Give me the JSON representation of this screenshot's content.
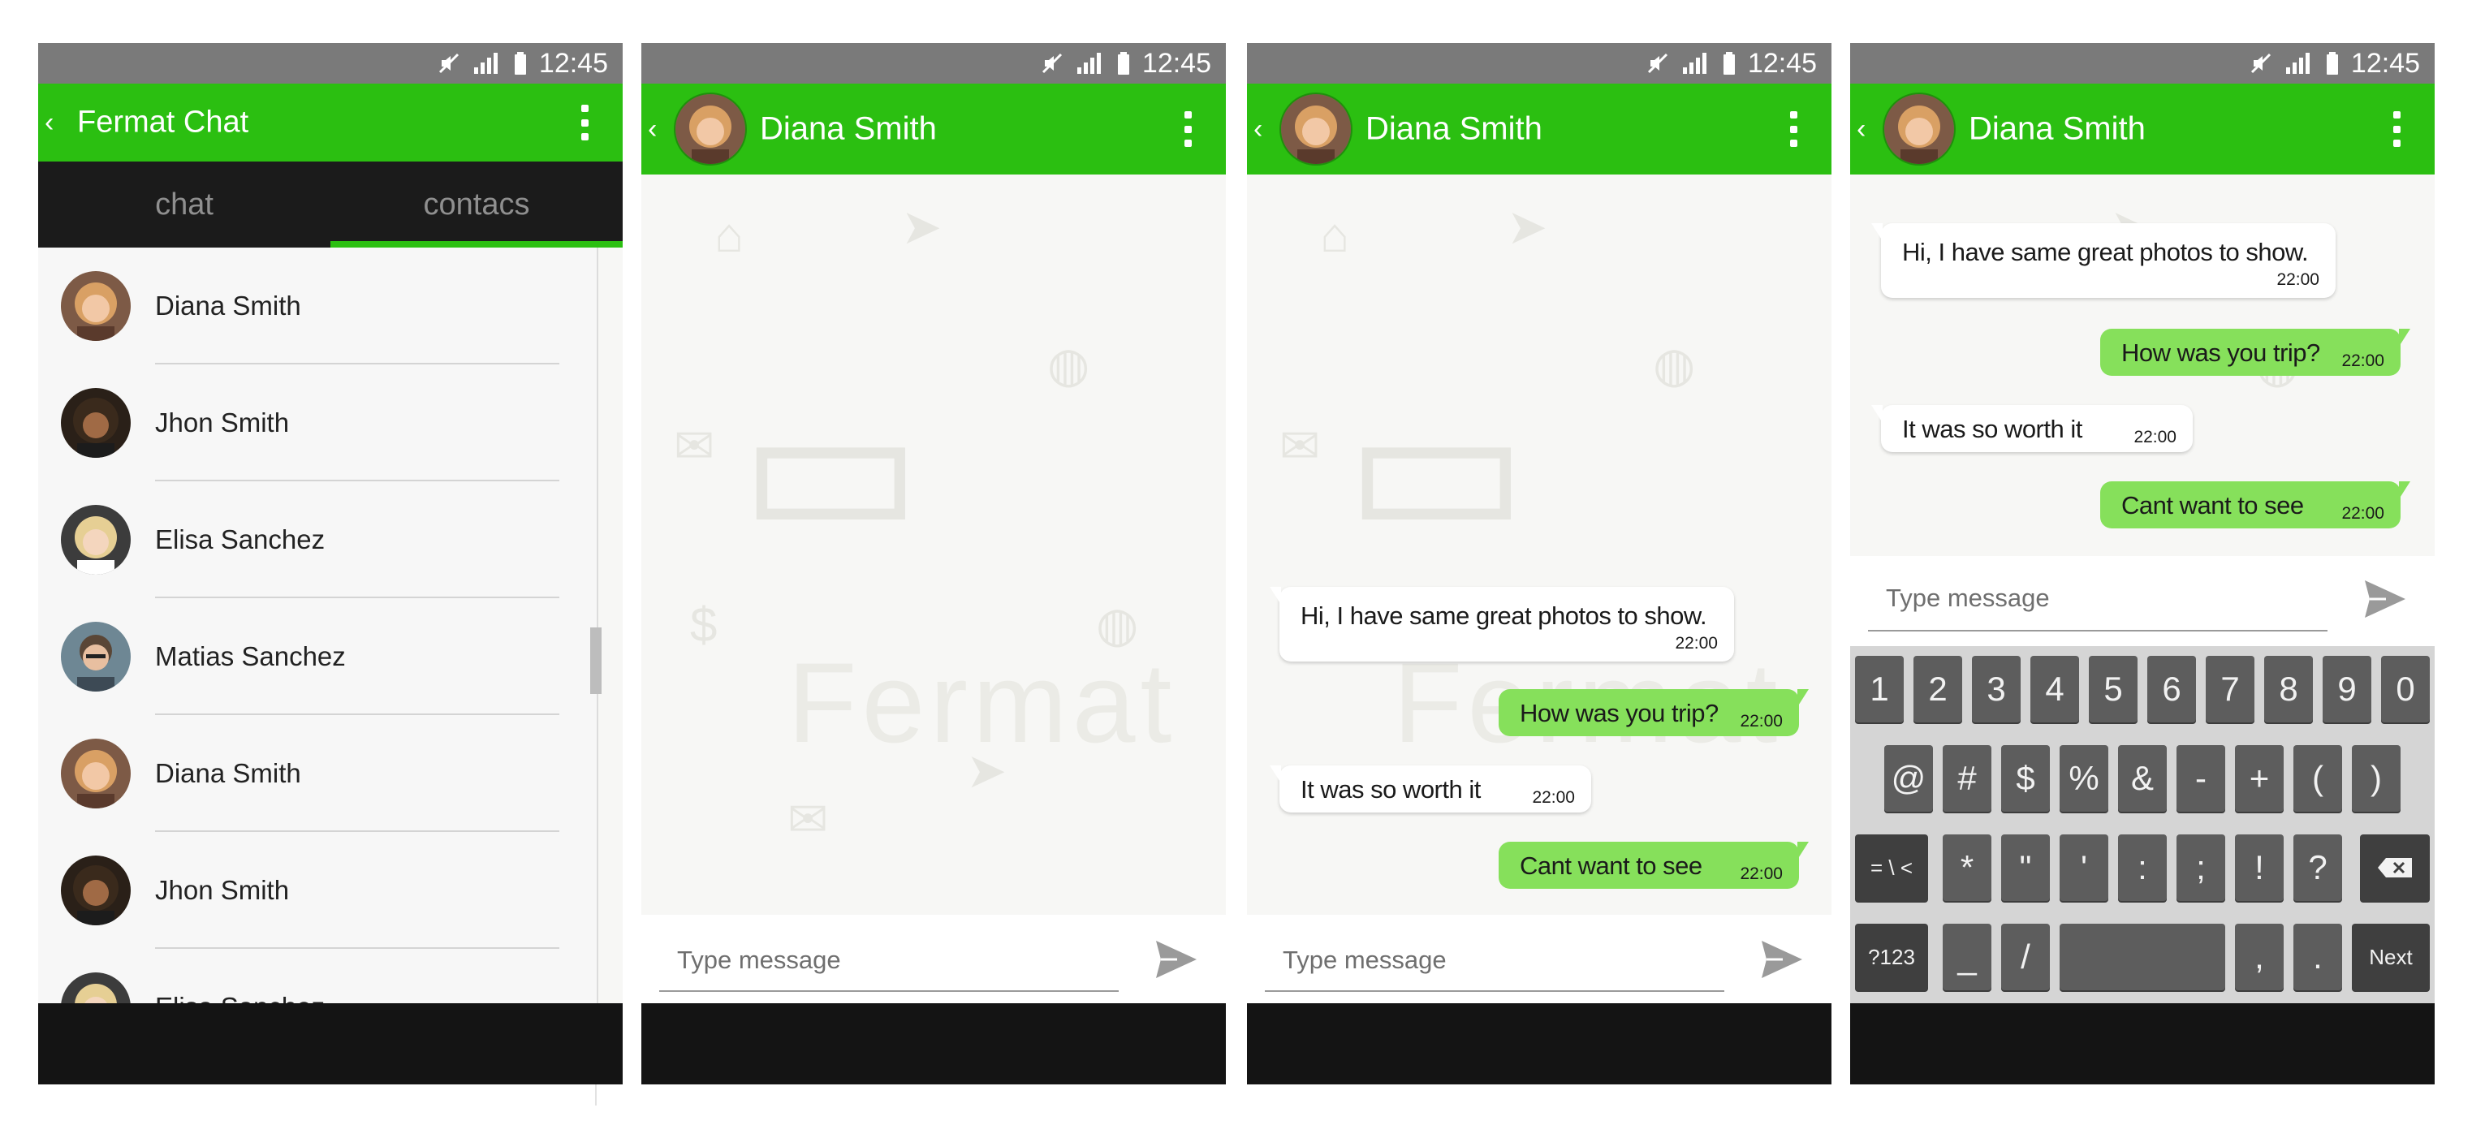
{
  "status": {
    "time": "12:45"
  },
  "screen1": {
    "app_title": "Fermat Chat",
    "tabs": [
      "chat",
      "contacs"
    ],
    "contacts": [
      "Diana Smith",
      "Jhon Smith",
      "Elisa Sanchez",
      "Matias Sanchez",
      "Diana Smith",
      "Jhon Smith",
      "Elisa Sanchez"
    ]
  },
  "conversation": {
    "contact_name": "Diana Smith",
    "composer_placeholder": "Type message",
    "wallpaper_text": "Fermat",
    "messages": [
      {
        "direction": "in",
        "text": "Hi, I have same great photos to show.",
        "time": "22:00"
      },
      {
        "direction": "out",
        "text": "How was you trip?",
        "time": "22:00"
      },
      {
        "direction": "in",
        "text": "It was so worth it",
        "time": "22:00"
      },
      {
        "direction": "out",
        "text": "Cant want to see",
        "time": "22:00"
      }
    ]
  },
  "keyboard": {
    "row1": [
      "1",
      "2",
      "3",
      "4",
      "5",
      "6",
      "7",
      "8",
      "9",
      "0"
    ],
    "row2": [
      "@",
      "#",
      "$",
      "%",
      "&",
      "-",
      "+",
      "(",
      ")"
    ],
    "row3": [
      "= \\ <",
      "*",
      "\"",
      "'",
      ":",
      ";",
      "!",
      "?"
    ],
    "row4": [
      "?123",
      "_",
      "/",
      ",",
      ".",
      "Next"
    ],
    "backspace_icon": "backspace-icon"
  },
  "colors": {
    "accent": "#2bbf11",
    "outgoing_bubble": "#86e05b",
    "status_bar": "#7a7a7a",
    "tab_bar": "#1b1b1b"
  }
}
